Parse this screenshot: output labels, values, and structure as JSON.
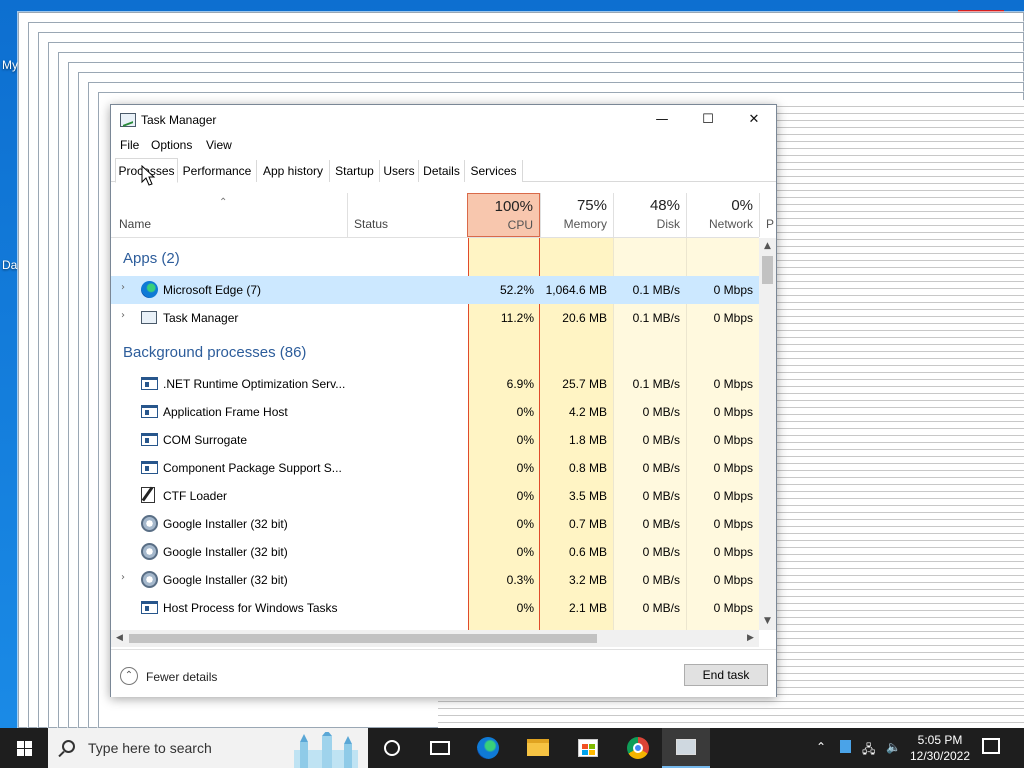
{
  "desktop": {
    "labels": [
      "My",
      "Da"
    ]
  },
  "window": {
    "title": "Task Manager",
    "controls": {
      "minimize": "—",
      "maximize": "☐",
      "close": "✕"
    },
    "menu": [
      "File",
      "Options",
      "View"
    ],
    "tabs": [
      "Processes",
      "Performance",
      "App history",
      "Startup",
      "Users",
      "Details",
      "Services"
    ],
    "active_tab": "Processes"
  },
  "columns": {
    "name": "Name",
    "status": "Status",
    "cpu": {
      "pct": "100%",
      "label": "CPU"
    },
    "memory": {
      "pct": "75%",
      "label": "Memory"
    },
    "disk": {
      "pct": "48%",
      "label": "Disk"
    },
    "network": {
      "pct": "0%",
      "label": "Network"
    },
    "power_partial": "P"
  },
  "groups": {
    "apps": "Apps (2)",
    "background": "Background processes (86)"
  },
  "apps": [
    {
      "name": "Microsoft Edge (7)",
      "icon": "edge-icon",
      "cpu": "52.2%",
      "memory": "1,064.6 MB",
      "disk": "0.1 MB/s",
      "network": "0 Mbps",
      "expandable": true,
      "selected": true
    },
    {
      "name": "Task Manager",
      "icon": "task-manager-icon",
      "cpu": "11.2%",
      "memory": "20.6 MB",
      "disk": "0.1 MB/s",
      "network": "0 Mbps",
      "expandable": true,
      "selected": false
    }
  ],
  "background": [
    {
      "name": ".NET Runtime Optimization Serv...",
      "icon": "process-icon",
      "cpu": "6.9%",
      "memory": "25.7 MB",
      "disk": "0.1 MB/s",
      "network": "0 Mbps",
      "expandable": false
    },
    {
      "name": "Application Frame Host",
      "icon": "process-icon",
      "cpu": "0%",
      "memory": "4.2 MB",
      "disk": "0 MB/s",
      "network": "0 Mbps",
      "expandable": false
    },
    {
      "name": "COM Surrogate",
      "icon": "process-icon",
      "cpu": "0%",
      "memory": "1.8 MB",
      "disk": "0 MB/s",
      "network": "0 Mbps",
      "expandable": false
    },
    {
      "name": "Component Package Support S...",
      "icon": "process-icon",
      "cpu": "0%",
      "memory": "0.8 MB",
      "disk": "0 MB/s",
      "network": "0 Mbps",
      "expandable": false
    },
    {
      "name": "CTF Loader",
      "icon": "ctf-icon",
      "cpu": "0%",
      "memory": "3.5 MB",
      "disk": "0 MB/s",
      "network": "0 Mbps",
      "expandable": false
    },
    {
      "name": "Google Installer (32 bit)",
      "icon": "google-installer-icon",
      "cpu": "0%",
      "memory": "0.7 MB",
      "disk": "0 MB/s",
      "network": "0 Mbps",
      "expandable": false
    },
    {
      "name": "Google Installer (32 bit)",
      "icon": "google-installer-icon",
      "cpu": "0%",
      "memory": "0.6 MB",
      "disk": "0 MB/s",
      "network": "0 Mbps",
      "expandable": false
    },
    {
      "name": "Google Installer (32 bit)",
      "icon": "google-installer-icon",
      "cpu": "0.3%",
      "memory": "3.2 MB",
      "disk": "0 MB/s",
      "network": "0 Mbps",
      "expandable": true
    },
    {
      "name": "Host Process for Windows Tasks",
      "icon": "process-icon",
      "cpu": "0%",
      "memory": "2.1 MB",
      "disk": "0 MB/s",
      "network": "0 Mbps",
      "expandable": false
    }
  ],
  "footer": {
    "fewer_details": "Fewer details",
    "end_task": "End task"
  },
  "taskbar": {
    "search_placeholder": "Type here to search",
    "time": "5:05 PM",
    "date": "12/30/2022"
  },
  "colors": {
    "accent": "#0078d7",
    "cpu_hot": "#f8c7ae",
    "usage_band": "#fff4c4",
    "group_text": "#2d5d9b",
    "selected_row": "#cce8ff"
  }
}
